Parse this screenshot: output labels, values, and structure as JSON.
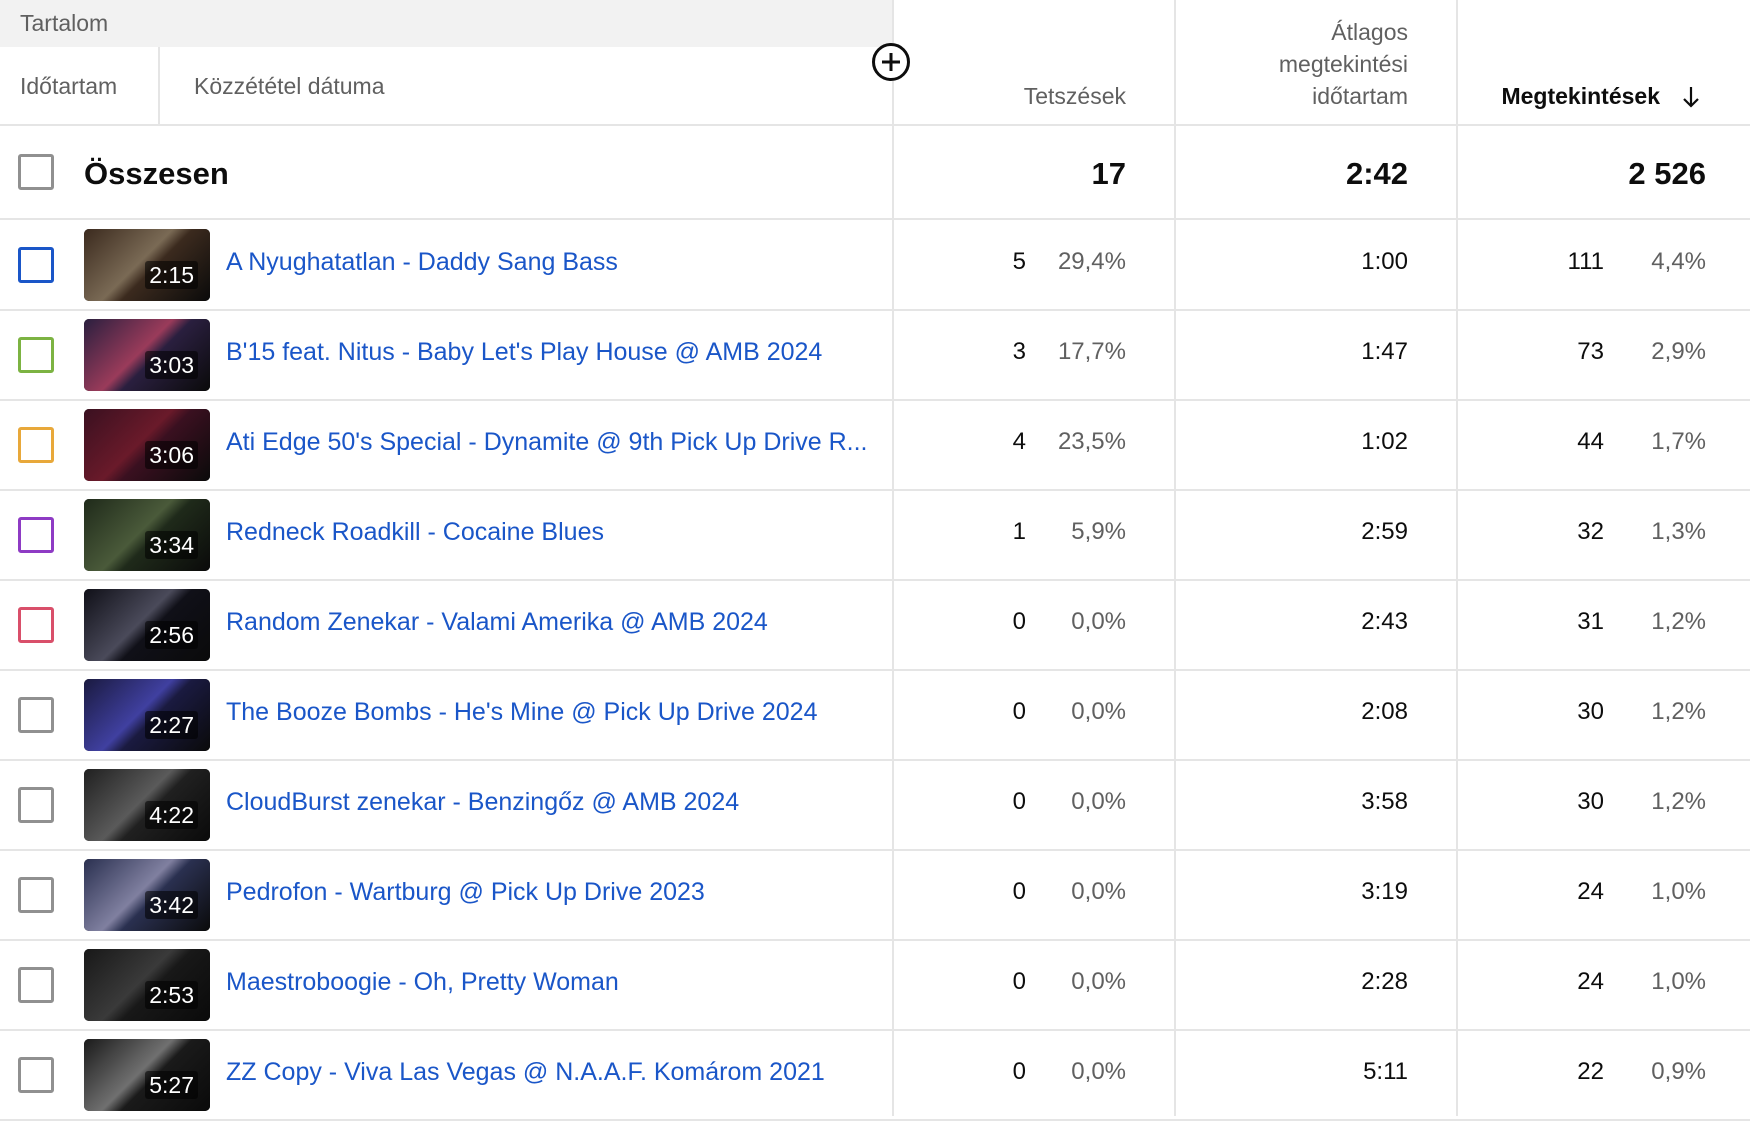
{
  "header": {
    "group_label": "Tartalom",
    "duration": "Időtartam",
    "pubdate": "Közzététel dátuma",
    "likes": "Tetszések",
    "avg_line1": "Átlagos",
    "avg_line2": "megtekintési",
    "avg_line3": "időtartam",
    "views": "Megtekintések"
  },
  "total": {
    "label": "Összesen",
    "likes": "17",
    "avg": "2:42",
    "views": "2 526"
  },
  "rows": [
    {
      "title": "A Nyughatatlan - Daddy Sang Bass",
      "duration": "2:15",
      "likes": "5",
      "likes_pct": "29,4%",
      "avg": "1:00",
      "views": "111",
      "views_pct": "4,4%",
      "color": "#1a56c8"
    },
    {
      "title": "B'15 feat. Nitus - Baby Let's Play House @ AMB 2024",
      "duration": "3:03",
      "likes": "3",
      "likes_pct": "17,7%",
      "avg": "1:47",
      "views": "73",
      "views_pct": "2,9%",
      "color": "#7cb342"
    },
    {
      "title": "Ati Edge 50's Special - Dynamite @ 9th Pick Up Drive R...",
      "duration": "3:06",
      "likes": "4",
      "likes_pct": "23,5%",
      "avg": "1:02",
      "views": "44",
      "views_pct": "1,7%",
      "color": "#e8a83a"
    },
    {
      "title": "Redneck Roadkill - Cocaine Blues",
      "duration": "3:34",
      "likes": "1",
      "likes_pct": "5,9%",
      "avg": "2:59",
      "views": "32",
      "views_pct": "1,3%",
      "color": "#8e3bc4"
    },
    {
      "title": "Random Zenekar - Valami Amerika @ AMB 2024",
      "duration": "2:56",
      "likes": "0",
      "likes_pct": "0,0%",
      "avg": "2:43",
      "views": "31",
      "views_pct": "1,2%",
      "color": "#d94f6a"
    },
    {
      "title": "The Booze Bombs - He's Mine @ Pick Up Drive 2024",
      "duration": "2:27",
      "likes": "0",
      "likes_pct": "0,0%",
      "avg": "2:08",
      "views": "30",
      "views_pct": "1,2%",
      "color": "#909090"
    },
    {
      "title": "CloudBurst zenekar - Benzingőz @ AMB 2024",
      "duration": "4:22",
      "likes": "0",
      "likes_pct": "0,0%",
      "avg": "3:58",
      "views": "30",
      "views_pct": "1,2%",
      "color": "#909090"
    },
    {
      "title": "Pedrofon - Wartburg @ Pick Up Drive 2023",
      "duration": "3:42",
      "likes": "0",
      "likes_pct": "0,0%",
      "avg": "3:19",
      "views": "24",
      "views_pct": "1,0%",
      "color": "#909090"
    },
    {
      "title": "Maestroboogie - Oh, Pretty Woman",
      "duration": "2:53",
      "likes": "0",
      "likes_pct": "0,0%",
      "avg": "2:28",
      "views": "24",
      "views_pct": "1,0%",
      "color": "#909090"
    },
    {
      "title": "ZZ Copy - Viva Las Vegas @ N.A.A.F. Komárom 2021",
      "duration": "5:27",
      "likes": "0",
      "likes_pct": "0,0%",
      "avg": "5:11",
      "views": "22",
      "views_pct": "0,9%",
      "color": "#909090"
    }
  ]
}
